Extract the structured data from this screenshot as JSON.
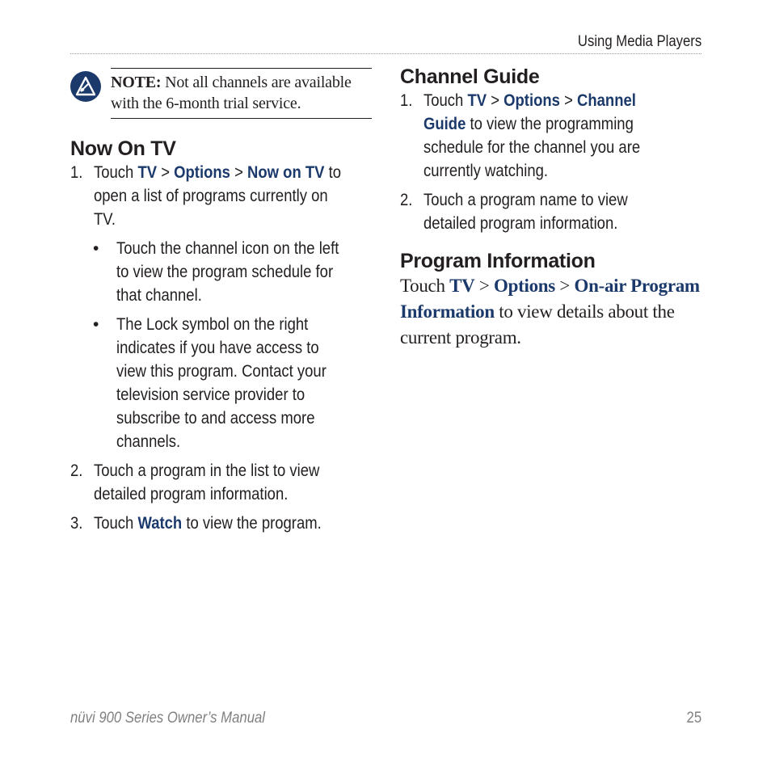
{
  "header": {
    "section_title": "Using Media Players"
  },
  "note": {
    "icon": "note-pencil-icon",
    "label": "NOTE:",
    "lines": [
      " Not all channels are available",
      "with the 6-month trial service."
    ]
  },
  "now_on_tv": {
    "heading": "Now On TV",
    "step1": {
      "num": "1.",
      "touch": "Touch ",
      "tv": "TV",
      "sep1": " > ",
      "options": "Options",
      "sep2": " > ",
      "target": "Now on TV",
      "rest_line1": " to",
      "line2": "open a list of programs currently on",
      "line3": "TV."
    },
    "bullets": [
      {
        "mark": "•",
        "lines": [
          "Touch the channel icon on the left",
          "to view the program schedule for",
          "that channel."
        ]
      },
      {
        "mark": "•",
        "lines": [
          "The Lock symbol on the right",
          "indicates if you have access to",
          "view this program. Contact your",
          "television service provider to",
          "subscribe to and access more",
          "channels."
        ]
      }
    ],
    "step2": {
      "num": "2.",
      "lines": [
        "Touch a program in the list to view",
        "detailed program information."
      ]
    },
    "step3": {
      "num": "3.",
      "touch": "Touch ",
      "target": "Watch",
      "rest": " to view the program."
    }
  },
  "channel_guide": {
    "heading": "Channel Guide",
    "step1": {
      "num": "1.",
      "touch": "Touch ",
      "tv": "TV",
      "sep1": " > ",
      "options": "Options",
      "sep2": " > ",
      "target_a": "Channel",
      "target_b": "Guide",
      "rest_line2": " to view the programming",
      "line3": "schedule for the channel you are",
      "line4": "currently watching."
    },
    "step2": {
      "num": "2.",
      "lines": [
        "Touch a program name to view",
        "detailed program information."
      ]
    }
  },
  "program_information": {
    "heading": "Program Information",
    "touch": "Touch ",
    "tv": "TV",
    "sep1": " > ",
    "options": "Options",
    "sep2": " > ",
    "target_a": "On-air Program",
    "target_b": "Information",
    "rest_line2": " to view details about the",
    "line3": "current program."
  },
  "footer": {
    "manual_title": "nüvi 900 Series Owner’s Manual",
    "page_number": "25"
  },
  "colors": {
    "link_blue": "#1b3a6b",
    "text": "#231f20",
    "footer_gray": "#808080"
  }
}
